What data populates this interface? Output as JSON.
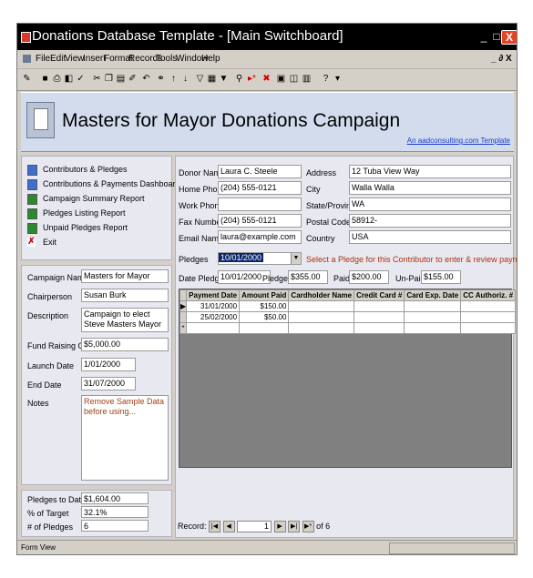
{
  "window": {
    "title": "Donations Database Template - [Main Switchboard]"
  },
  "menu": [
    "File",
    "Edit",
    "View",
    "Insert",
    "Format",
    "Records",
    "Tools",
    "Window",
    "Help"
  ],
  "menu_controls": "_ ∂ X",
  "header": {
    "title": "Masters for Mayor Donations Campaign",
    "link": "An aadconsulting.com Template"
  },
  "switchboard": [
    {
      "label": "Contributors & Pledges",
      "icon": "blue-button-icon"
    },
    {
      "label": "Contributions & Payments Dashboard",
      "icon": "blue-button-icon"
    },
    {
      "label": "Campaign Summary Report",
      "icon": "report-icon"
    },
    {
      "label": "Pledges Listing Report",
      "icon": "report-icon"
    },
    {
      "label": "Unpaid Pledges Report",
      "icon": "report-icon"
    },
    {
      "label": "Exit",
      "icon": "exit-icon"
    }
  ],
  "campaign": {
    "name_label": "Campaign Name",
    "name": "Masters for Mayor",
    "chair_label": "Chairperson",
    "chair": "Susan Burk",
    "desc_label": "Description",
    "desc": "Campaign to elect Steve Masters Mayor",
    "goal_label": "Fund Raising Goal",
    "goal": "$5,000.00",
    "launch_label": "Launch Date",
    "launch": "1/01/2000",
    "end_label": "End Date",
    "end": "31/07/2000",
    "notes_label": "Notes",
    "notes": "Remove Sample Data before using..."
  },
  "totals": {
    "pledges_label": "Pledges to Date",
    "pledges": "$1,604.00",
    "pct_label": "% of Target",
    "pct": "32.1%",
    "count_label": "# of Pledges",
    "count": "6"
  },
  "donor": {
    "name_label": "Donor Name",
    "name": "Laura C. Steele",
    "home_label": "Home Phone",
    "home": "(204) 555-0121",
    "work_label": "Work Phone",
    "work": "",
    "fax_label": "Fax Number",
    "fax": "(204) 555-0121",
    "email_label": "Email Name",
    "email": "laura@example.com",
    "address_label": "Address",
    "address": "12 Tuba View Way",
    "city_label": "City",
    "city": "Walla Walla",
    "state_label": "State/Province",
    "state": "WA",
    "postal_label": "Postal Code",
    "postal": "58912-",
    "country_label": "Country",
    "country": "USA"
  },
  "pledge": {
    "label": "Pledges",
    "value": "10/01/2000",
    "hint": "Select a Pledge for this Contributor to enter & review payments received...",
    "date_label": "Date Pledged",
    "date": "10/01/2000",
    "pledged_label": "Pledged",
    "pledged": "$355.00",
    "paid_label": "Paid",
    "paid": "$200.00",
    "unpaid_label": "Un-Paid",
    "unpaid": "$155.00"
  },
  "payments": {
    "headers": [
      "Payment Date",
      "Amount Paid",
      "Cardholder Name",
      "Credit Card #",
      "Card Exp. Date",
      "CC Authoriz. #"
    ],
    "rows": [
      [
        "31/01/2000",
        "$150.00",
        "",
        "",
        "",
        ""
      ],
      [
        "25/02/2000",
        "$50.00",
        "",
        "",
        "",
        ""
      ]
    ]
  },
  "nav": {
    "record_label": "Record:",
    "current": "1",
    "of_label": "of 6"
  },
  "status": {
    "text": "Form View"
  }
}
